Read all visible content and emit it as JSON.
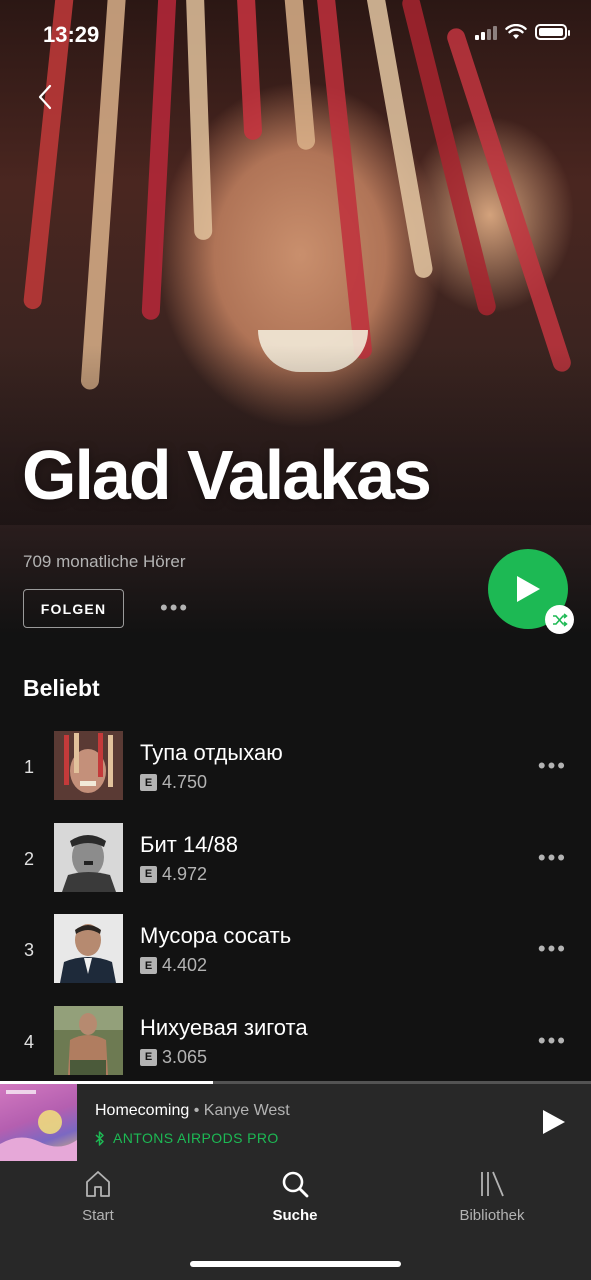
{
  "status_bar": {
    "time": "13:29"
  },
  "artist": {
    "name": "Glad Valakas",
    "monthly_listeners": "709 monatliche Hörer",
    "follow_label": "FOLGEN"
  },
  "popular": {
    "title": "Beliebt",
    "tracks": [
      {
        "number": "1",
        "title": "Тупа отдыхаю",
        "explicit": "E",
        "plays": "4.750"
      },
      {
        "number": "2",
        "title": "Бит 14/88",
        "explicit": "E",
        "plays": "4.972"
      },
      {
        "number": "3",
        "title": "Мусора сосать",
        "explicit": "E",
        "plays": "4.402"
      },
      {
        "number": "4",
        "title": "Нихуевая зигота",
        "explicit": "E",
        "plays": "3.065"
      }
    ]
  },
  "now_playing": {
    "song": "Homecoming",
    "separator": " • ",
    "artist": "Kanye West",
    "device": "ANTONS AIRPODS PRO",
    "progress": 0.36
  },
  "tabs": [
    {
      "label": "Start",
      "icon": "home-icon"
    },
    {
      "label": "Suche",
      "icon": "search-icon",
      "active": true
    },
    {
      "label": "Bibliothek",
      "icon": "library-icon"
    }
  ],
  "colors": {
    "accent": "#1db954",
    "background": "#121212",
    "player": "#282828"
  }
}
